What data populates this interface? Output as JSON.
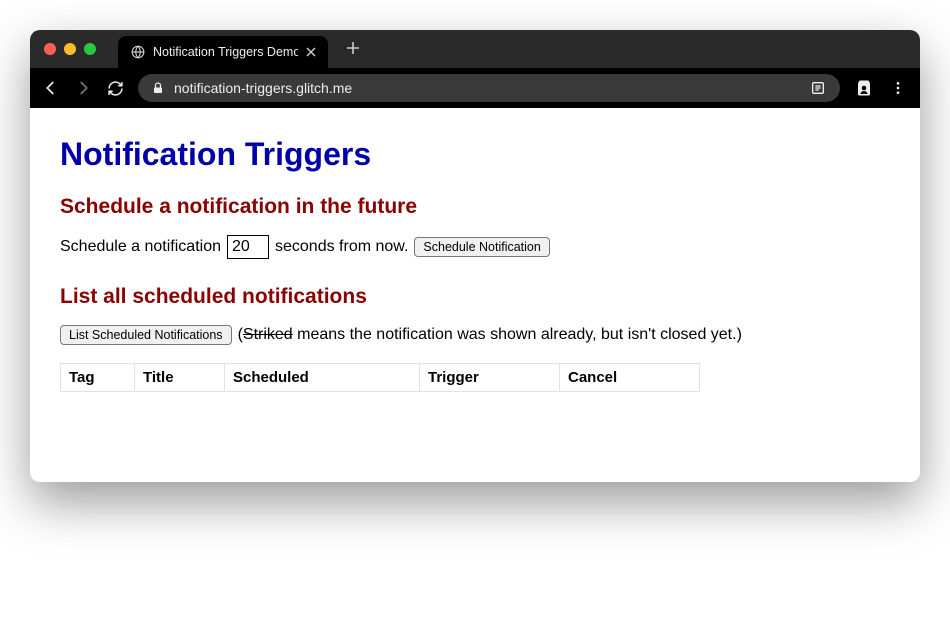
{
  "browser": {
    "tab_title": "Notification Triggers Demo",
    "url": "notification-triggers.glitch.me"
  },
  "page": {
    "h1": "Notification Triggers",
    "schedule": {
      "heading": "Schedule a notification in the future",
      "prefix": "Schedule a notification",
      "seconds_value": "20",
      "suffix": "seconds from now.",
      "button": "Schedule Notification"
    },
    "list": {
      "heading": "List all scheduled notifications",
      "button": "List Scheduled Notifications",
      "note_open": "(",
      "note_striked": "Striked",
      "note_rest": " means the notification was shown already, but isn't closed yet.)"
    },
    "table": {
      "headers": [
        "Tag",
        "Title",
        "Scheduled",
        "Trigger",
        "Cancel"
      ]
    }
  }
}
